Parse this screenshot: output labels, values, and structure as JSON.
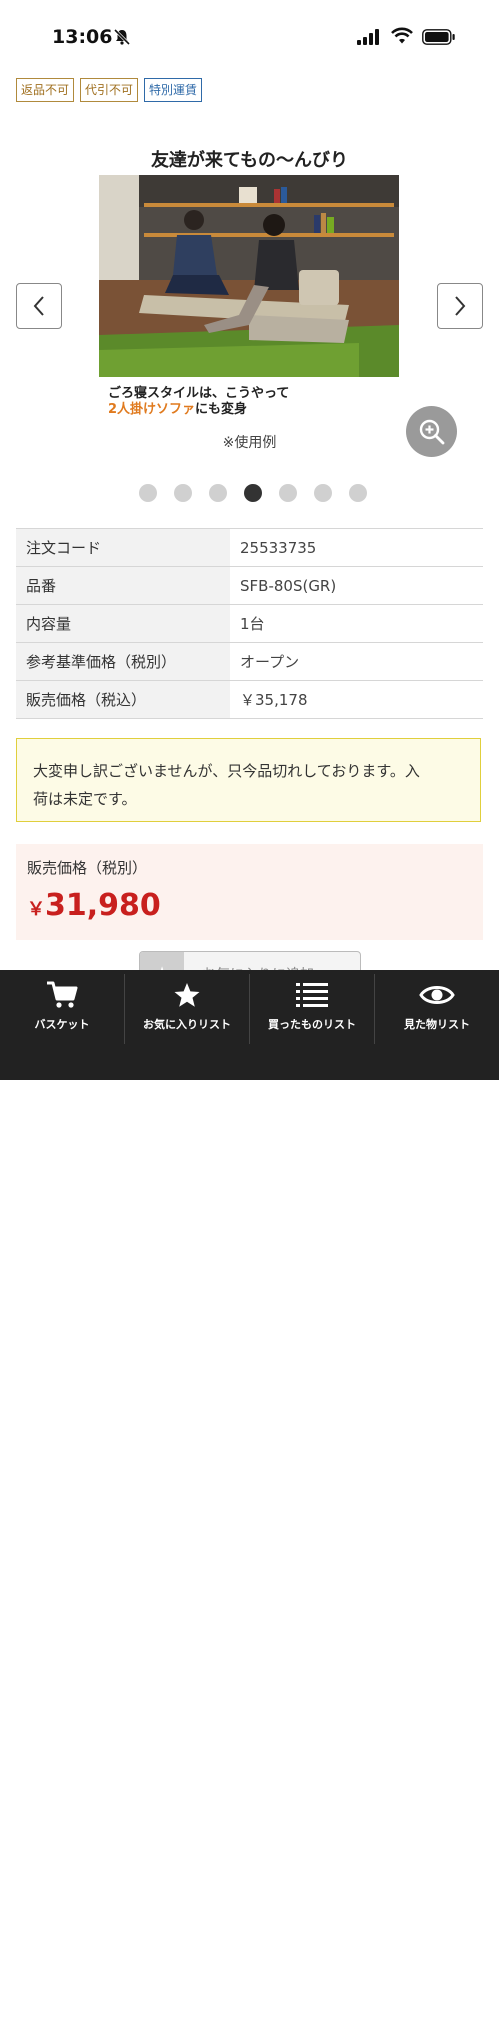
{
  "status_bar": {
    "time": "13:06"
  },
  "tags": [
    "返品不可",
    "代引不可",
    "特別運賃"
  ],
  "gallery": {
    "title": "友達が来てもの〜んびり",
    "caption_line1": "ごろ寝スタイルは、こうやって",
    "caption_line2_highlight": "2人掛けソファ",
    "caption_line2_rest": "にも変身",
    "note": "※使用例",
    "dot_count": 7,
    "active_dot": 3
  },
  "specs": [
    {
      "key": "注文コード",
      "value": "25533735"
    },
    {
      "key": "品番",
      "value": "SFB-80S(GR)"
    },
    {
      "key": "内容量",
      "value": "1台"
    },
    {
      "key": "参考基準価格（税別）",
      "value": "オープン"
    },
    {
      "key": "販売価格（税込）",
      "value": "￥35,178"
    }
  ],
  "notice": {
    "line1": "大変申し訳ございませんが、只今品切れしております。入",
    "line2": "荷は未定です。"
  },
  "price": {
    "label": "販売価格（税別）",
    "currency": "￥",
    "value": "31,980",
    "color": "#c8201e"
  },
  "favorite_button": {
    "label": "お気に入りに追加"
  },
  "tabbar": [
    {
      "label": "バスケット",
      "icon": "cart-icon"
    },
    {
      "label": "お気に入りリスト",
      "icon": "star-icon"
    },
    {
      "label": "買ったものリスト",
      "icon": "list-icon"
    },
    {
      "label": "見た物リスト",
      "icon": "eye-icon"
    }
  ]
}
